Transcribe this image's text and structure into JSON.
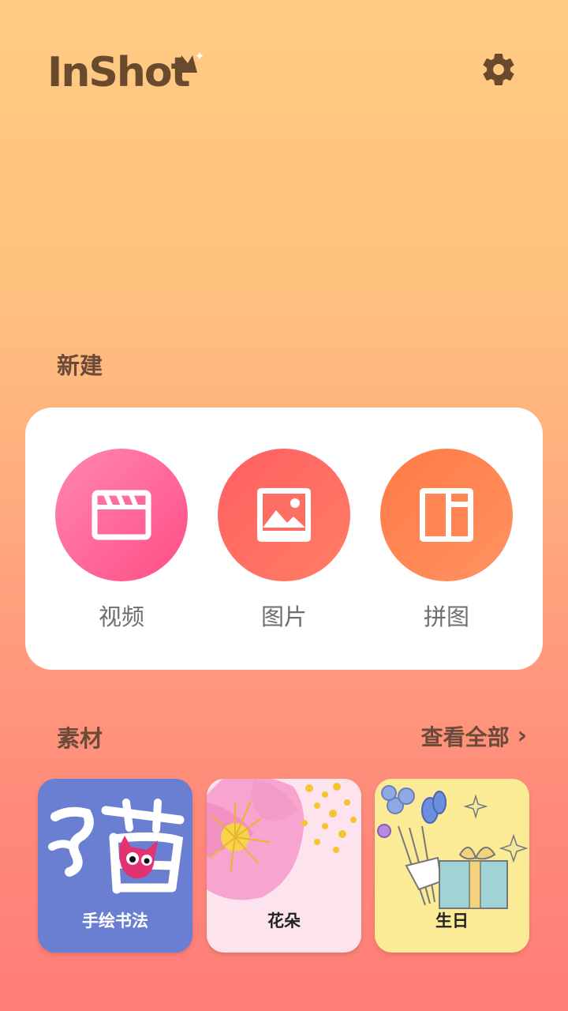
{
  "header": {
    "logo_text": "InShot",
    "settings_icon": "gear-icon"
  },
  "new_section": {
    "title": "新建",
    "items": [
      {
        "label": "视频",
        "icon": "clapperboard-icon",
        "color": "#FF5A8E"
      },
      {
        "label": "图片",
        "icon": "image-icon",
        "color": "#FF6A62"
      },
      {
        "label": "拼图",
        "icon": "collage-icon",
        "color": "#FF8450"
      }
    ]
  },
  "material_section": {
    "title": "素材",
    "view_all": "查看全部",
    "tiles": [
      {
        "label": "手绘书法",
        "bg": "#6A7ED2"
      },
      {
        "label": "花朵",
        "bg": "#FDE3EE"
      },
      {
        "label": "生日",
        "bg": "#FCEB96"
      }
    ]
  },
  "colors": {
    "bg_top": "#FFCB84",
    "bg_bottom": "#FF7D78",
    "text_brown": "#6B4A3A"
  }
}
